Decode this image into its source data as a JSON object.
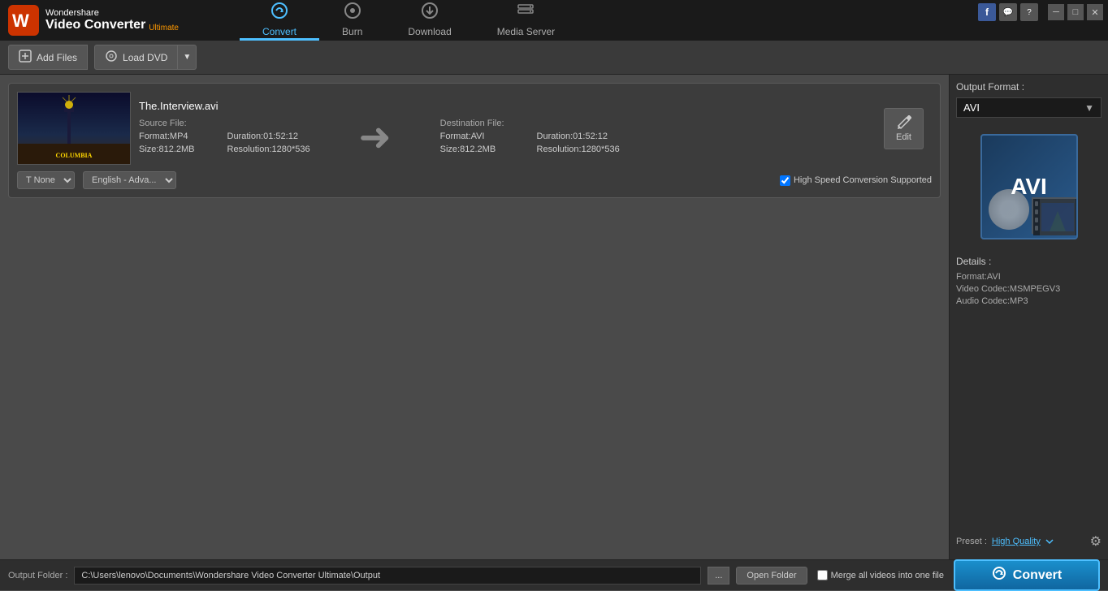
{
  "app": {
    "brand": "Wondershare",
    "product_line1": "Video Converter",
    "product_line2": "Ultimate",
    "logo_color": "#ff6600"
  },
  "nav": {
    "tabs": [
      {
        "id": "convert",
        "label": "Convert",
        "icon": "↻",
        "active": true
      },
      {
        "id": "burn",
        "label": "Burn",
        "icon": "●",
        "active": false
      },
      {
        "id": "download",
        "label": "Download",
        "icon": "⬇",
        "active": false
      },
      {
        "id": "media-server",
        "label": "Media Server",
        "icon": "≋",
        "active": false
      }
    ]
  },
  "toolbar": {
    "add_files_label": "Add Files",
    "load_dvd_label": "Load DVD"
  },
  "file_item": {
    "filename": "The.Interview.avi",
    "source": {
      "label": "Source File:",
      "format_label": "Format:",
      "format_value": "MP4",
      "duration_label": "Duration:",
      "duration_value": "01:52:12",
      "size_label": "Size:",
      "size_value": "812.2MB",
      "resolution_label": "Resolution:",
      "resolution_value": "1280*536"
    },
    "destination": {
      "label": "Destination File:",
      "format_label": "Format:",
      "format_value": "AVI",
      "duration_label": "Duration:",
      "duration_value": "01:52:12",
      "size_label": "Size:",
      "size_value": "812.2MB",
      "resolution_label": "Resolution:",
      "resolution_value": "1280*536"
    },
    "edit_label": "Edit",
    "subtitle_options": [
      "None"
    ],
    "subtitle_selected": "T None",
    "audio_selected": "English - Adva...",
    "hd_checkbox_label": "High Speed Conversion Supported"
  },
  "right_panel": {
    "output_format_label": "Output Format :",
    "format_selected": "AVI",
    "details_label": "Details :",
    "details": [
      {
        "label": "Format:AVI"
      },
      {
        "label": "Video Codec:MSMPEGV3"
      },
      {
        "label": "Audio Codec:MP3"
      }
    ],
    "preset_label": "Preset :",
    "preset_value": "High Quality",
    "settings_icon": "⚙"
  },
  "bottom_bar": {
    "output_folder_label": "Output Folder :",
    "output_folder_path": "C:\\Users\\lenovo\\Documents\\Wondershare Video Converter Ultimate\\Output",
    "browse_label": "...",
    "open_folder_label": "Open Folder",
    "merge_label": "Merge all videos into one file",
    "convert_label": "Convert"
  },
  "window_controls": {
    "minimize": "─",
    "maximize": "□",
    "close": "✕"
  }
}
